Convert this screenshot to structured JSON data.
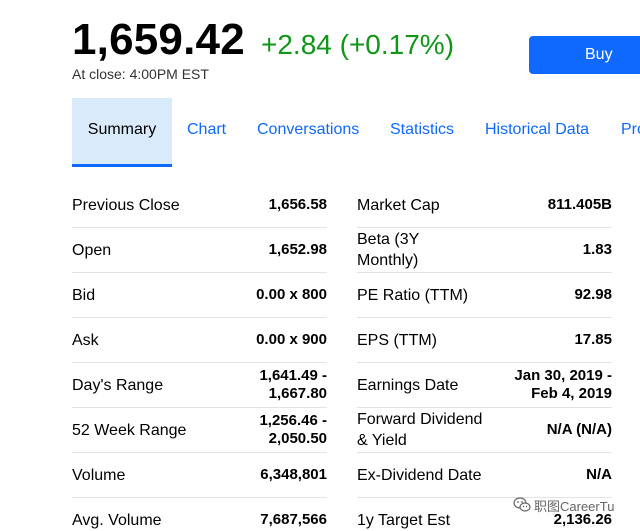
{
  "quote": {
    "price": "1,659.42",
    "change": "+2.84 (+0.17%)",
    "close_time": "At close: 4:00PM EST",
    "buy_label": "Buy",
    "change_color": "#109618"
  },
  "tabs": [
    {
      "label": "Summary",
      "active": true
    },
    {
      "label": "Chart",
      "active": false
    },
    {
      "label": "Conversations",
      "active": false
    },
    {
      "label": "Statistics",
      "active": false
    },
    {
      "label": "Historical Data",
      "active": false
    },
    {
      "label": "Pro",
      "active": false
    }
  ],
  "summary_left": [
    {
      "label": "Previous Close",
      "value": "1,656.58"
    },
    {
      "label": "Open",
      "value": "1,652.98"
    },
    {
      "label": "Bid",
      "value": "0.00 x 800"
    },
    {
      "label": "Ask",
      "value": "0.00 x 900"
    },
    {
      "label": "Day's Range",
      "value": "1,641.49 -\n1,667.80"
    },
    {
      "label": "52 Week Range",
      "value": "1,256.46 -\n2,050.50"
    },
    {
      "label": "Volume",
      "value": "6,348,801"
    },
    {
      "label": "Avg. Volume",
      "value": "7,687,566"
    }
  ],
  "summary_right": [
    {
      "label": "Market Cap",
      "value": "811.405B"
    },
    {
      "label": "Beta (3Y\nMonthly)",
      "value": "1.83"
    },
    {
      "label": "PE Ratio (TTM)",
      "value": "92.98"
    },
    {
      "label": "EPS (TTM)",
      "value": "17.85"
    },
    {
      "label": "Earnings Date",
      "value": "Jan 30, 2019 -\nFeb 4, 2019"
    },
    {
      "label": "Forward Dividend\n& Yield",
      "value": "N/A (N/A)"
    },
    {
      "label": "Ex-Dividend Date",
      "value": "N/A"
    },
    {
      "label": "1y Target Est",
      "value": "2,136.26"
    }
  ],
  "watermark": {
    "text": "职图CareerTu",
    "icon": "wechat-icon"
  },
  "colors": {
    "accent": "#0f69ff",
    "active_tab_bg": "#d9ebfb",
    "positive": "#109618"
  }
}
